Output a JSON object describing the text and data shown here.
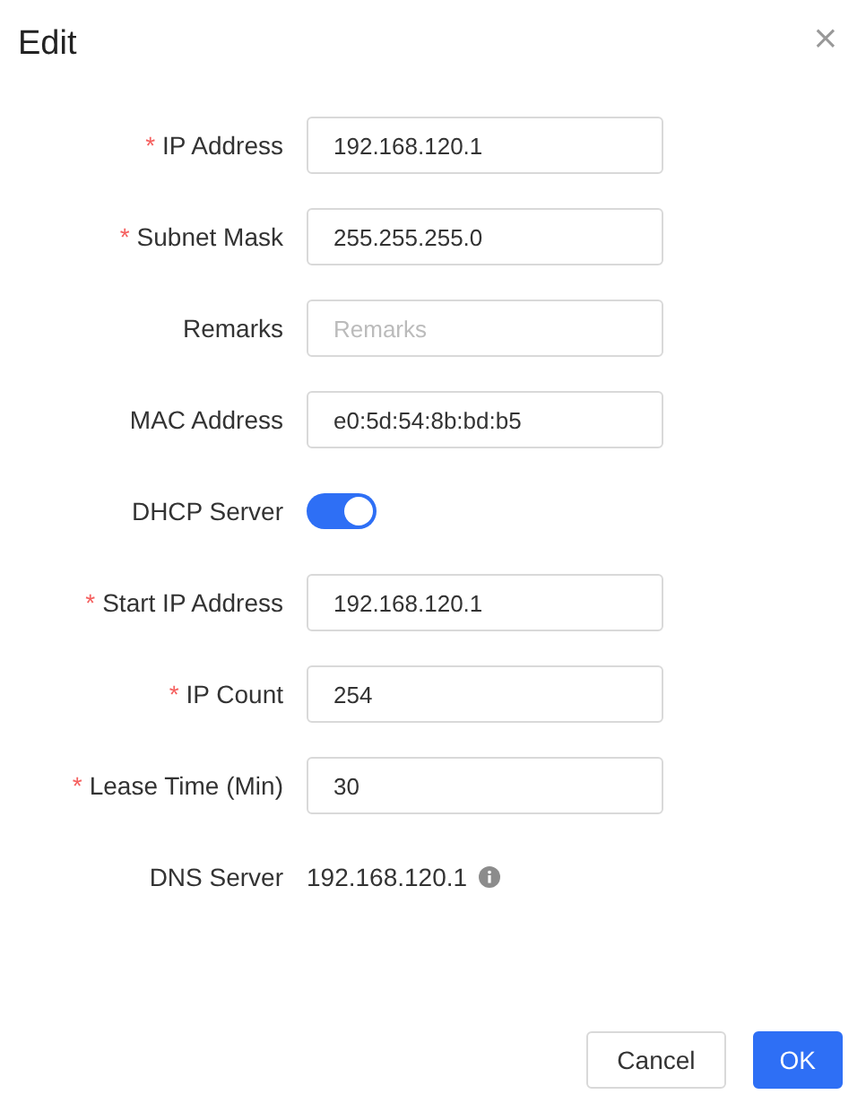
{
  "dialog": {
    "title": "Edit",
    "close": "×"
  },
  "fields": [
    {
      "kind": "input",
      "marker": "*",
      "label": "IP Address",
      "value": "192.168.120.1"
    },
    {
      "kind": "input",
      "marker": "*",
      "label": "Subnet Mask",
      "value": "255.255.255.0"
    },
    {
      "kind": "input",
      "label": "Remarks",
      "placeholder": "Remarks"
    },
    {
      "kind": "input",
      "label": "MAC Address",
      "value": "e0:5d:54:8b:bd:b5"
    },
    {
      "kind": "toggle",
      "label": "DHCP Server",
      "on": true
    },
    {
      "kind": "input",
      "marker": "*",
      "label": "Start IP Address",
      "value": "192.168.120.1"
    },
    {
      "kind": "input",
      "marker": "*",
      "label": "IP Count",
      "value": "254"
    },
    {
      "kind": "input",
      "marker": "*",
      "label": "Lease Time (Min)",
      "value": "30"
    },
    {
      "kind": "text",
      "label": "DNS Server",
      "value": "192.168.120.1",
      "info": true
    }
  ],
  "buttons": [
    {
      "label": "Cancel",
      "primary": false
    },
    {
      "label": "OK",
      "primary": true
    }
  ]
}
